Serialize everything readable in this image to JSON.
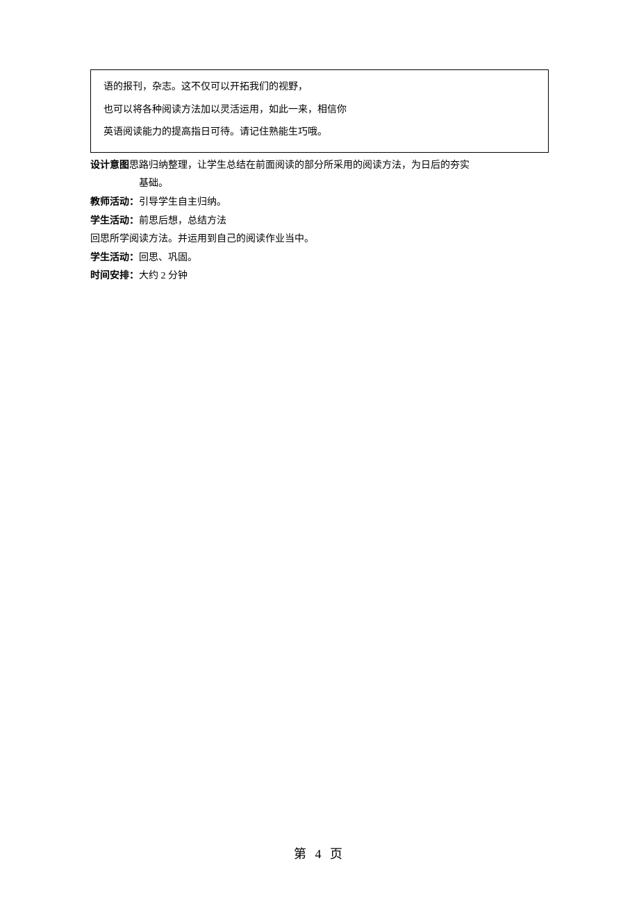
{
  "box": {
    "line1": "语的报刊，杂志。这不仅可以开拓我们的视野，",
    "line2": "也可以将各种阅读方法加以灵活运用，如此一来，相信你",
    "line3": "英语阅读能力的提高指日可待。请记住熟能生巧哦。"
  },
  "content": {
    "design_label": "设计意图",
    "design_sep": "：",
    "design_text1": "思路归纳整理，让学生总结在前面阅读的部分所采用的阅读方法，为日后的夯实",
    "design_text2": "基础。",
    "teacher_label": "教师活动：",
    "teacher_text": "引导学生自主归纳。",
    "student1_label": "学生活动：",
    "student1_text": "前思后想，总结方法",
    "recall_text": "回思所学阅读方法。并运用到自己的阅读作业当中。",
    "student2_label": "学生活动：",
    "student2_text": "回思、巩固。",
    "time_label": "时间安排：",
    "time_text": "大约 2 分钟"
  },
  "footer": "第 4 页"
}
